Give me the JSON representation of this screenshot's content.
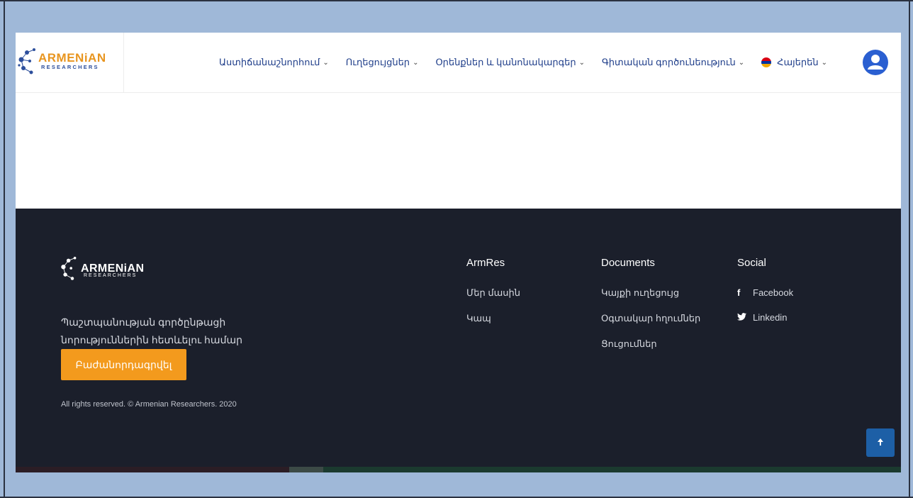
{
  "header": {
    "logo_title": "ARMENiAN",
    "logo_sub": "RESEARCHERS",
    "nav": [
      {
        "label": "Աստիճանաշնորհում",
        "icon": "chevron-down-icon"
      },
      {
        "label": "Ուղեցույցներ",
        "icon": "chevron-down-icon"
      },
      {
        "label": "Օրենքներ և կանոնակարգեր",
        "icon": "chevron-down-icon"
      },
      {
        "label": "Գիտական գործունեություն",
        "icon": "chevron-down-icon"
      }
    ],
    "language": {
      "label": "Հայերեն",
      "icon": "armenia-flag-icon",
      "flag_colors": [
        "#d90012",
        "#0033a0",
        "#f2a800"
      ]
    },
    "user_icon": "user-icon"
  },
  "footer": {
    "logo_title": "ARMENiAN",
    "logo_sub": "RESEARCHERS",
    "description": "Պաշտպանության գործընթացի նորություններին հետևելու համար",
    "subscribe_label": "Բաժանորդագրվել",
    "copyright": "All rights reserved. © Armenian Researchers. 2020",
    "columns": [
      {
        "title": "ArmRes",
        "links": [
          "Մեր մասին",
          "Կապ"
        ]
      },
      {
        "title": "Documents",
        "links": [
          "Կայքի ուղեցույց",
          "Օգտակար հղումներ",
          "Ցուցումներ"
        ]
      },
      {
        "title": "Social",
        "links": [
          {
            "label": "Facebook",
            "icon": "facebook-icon"
          },
          {
            "label": "Linkedin",
            "icon": "twitter-icon"
          }
        ]
      }
    ],
    "scroll_top_icon": "arrow-up-icon"
  },
  "colors": {
    "accent": "#f39a1d",
    "brand_blue": "#1f3e8a",
    "footer_bg": "#1b1f2b",
    "user_btn": "#2a5fd1"
  }
}
